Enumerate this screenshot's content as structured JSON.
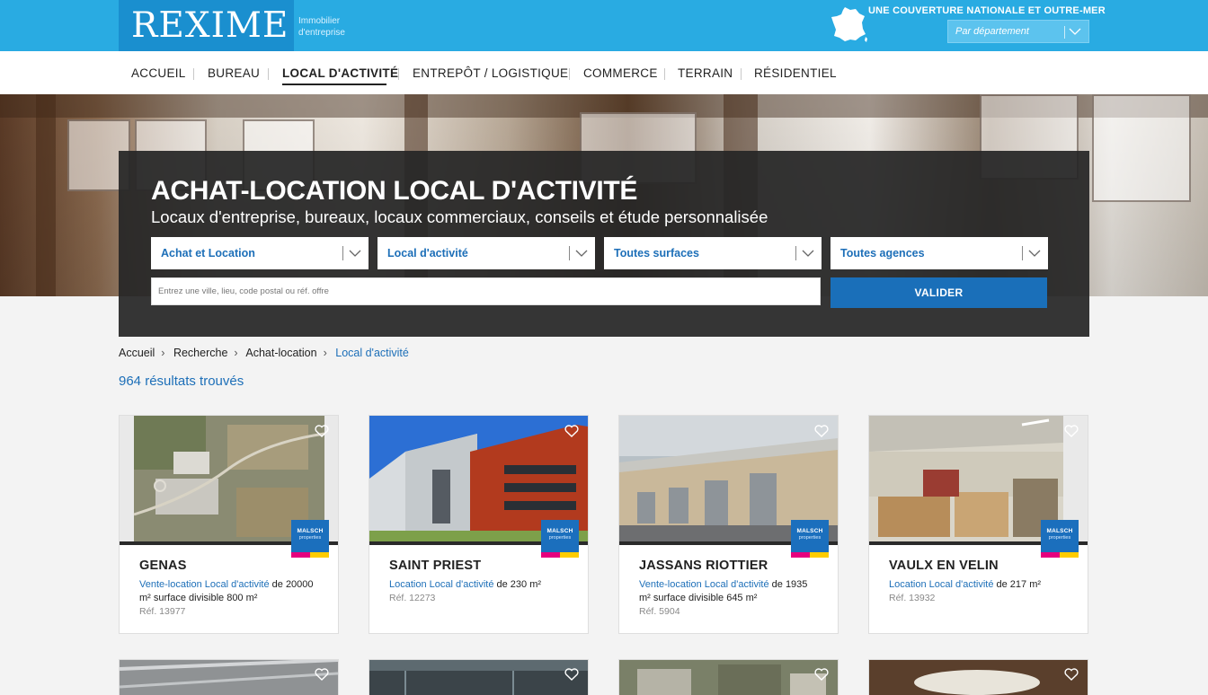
{
  "header": {
    "logo": "REXIME",
    "tagline_line1": "Immobilier",
    "tagline_line2": "d'entreprise",
    "coverage": "UNE COUVERTURE NATIONALE ET OUTRE-MER",
    "department_select": "Par département",
    "map_icon": "france-map-icon"
  },
  "nav": {
    "items": [
      {
        "label": "ACCUEIL"
      },
      {
        "label": "BUREAU"
      },
      {
        "label": "LOCAL D'ACTIVITÉ",
        "active": true
      },
      {
        "label": "ENTREPÔT / LOGISTIQUE"
      },
      {
        "label": "COMMERCE"
      },
      {
        "label": "TERRAIN"
      },
      {
        "label": "RÉSIDENTIEL"
      }
    ]
  },
  "hero": {
    "title": "ACHAT-LOCATION LOCAL D'ACTIVITÉ",
    "subtitle": "Locaux d'entreprise, bureaux, locaux commerciaux, conseils et étude personnalisée",
    "filters": [
      {
        "value": "Achat et Location"
      },
      {
        "value": "Local d'activité"
      },
      {
        "value": "Toutes surfaces"
      },
      {
        "value": "Toutes agences"
      }
    ],
    "search_placeholder": "Entrez une ville, lieu, code postal ou réf. offre",
    "submit_label": "VALIDER"
  },
  "breadcrumb": [
    "Accueil",
    "Recherche",
    "Achat-location",
    "Local d'activité"
  ],
  "results_count": "964 résultats trouvés",
  "badge": {
    "name": "MALSCH",
    "sub": "properties"
  },
  "listings": [
    {
      "city": "GENAS",
      "type_link": "Vente-location Local d'activité",
      "details": " de 20000 m² surface divisible 800 m²",
      "ref": "Réf. 13977",
      "photo": "aerial"
    },
    {
      "city": "SAINT PRIEST",
      "type_link": "Location Local d'activité",
      "details": " de 230 m²",
      "ref": "Réf. 12273",
      "photo": "facade"
    },
    {
      "city": "JASSANS RIOTTIER",
      "type_link": "Vente-location Local d'activité",
      "details": " de 1935 m² surface divisible 645 m²",
      "ref": "Réf. 5904",
      "photo": "warehouse"
    },
    {
      "city": "VAULX EN VELIN",
      "type_link": "Location Local d'activité",
      "details": " de 217 m²",
      "ref": "Réf. 13932",
      "photo": "interior"
    }
  ],
  "colors": {
    "brand_blue": "#29abe2",
    "link_blue": "#1d6fb8",
    "button_blue": "#1a6fb9"
  }
}
